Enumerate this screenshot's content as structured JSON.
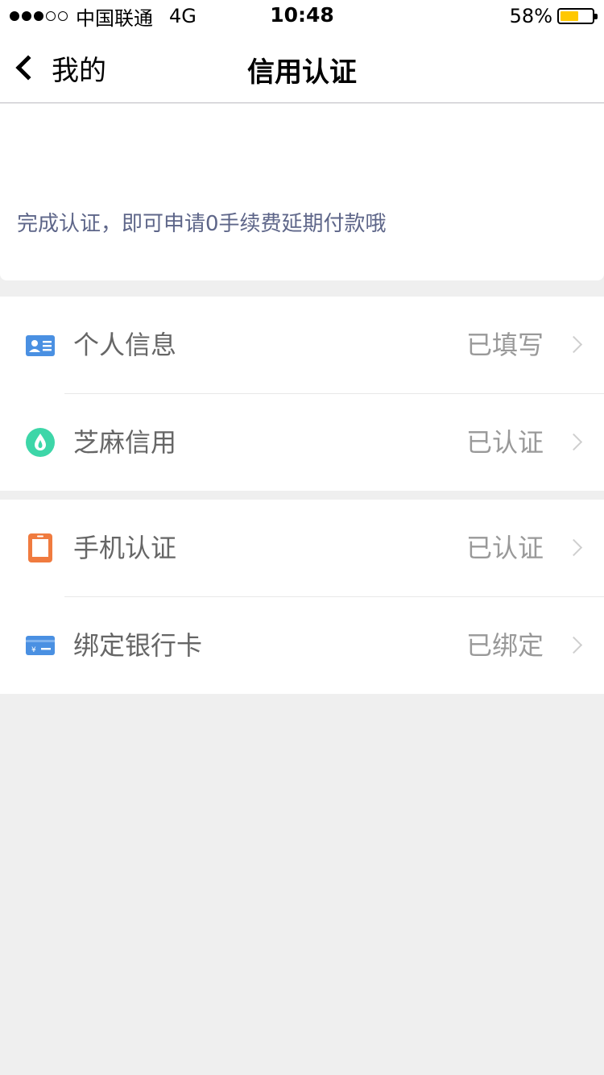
{
  "status_bar": {
    "carrier": "中国联通",
    "network": "4G",
    "time": "10:48",
    "battery": "58%",
    "battery_level": 0.58,
    "signal_strength": 3
  },
  "nav": {
    "back_label": "我的",
    "title": "信用认证"
  },
  "banner": {
    "text": "完成认证，即可申请0手续费延期付款哦"
  },
  "groups": [
    {
      "items": [
        {
          "label": "个人信息",
          "status": "已填写",
          "icon": "id-card-icon",
          "color": "#4a90e2"
        },
        {
          "label": "芝麻信用",
          "status": "已认证",
          "icon": "sesame-credit-icon",
          "color": "#3dd6a8"
        }
      ]
    },
    {
      "items": [
        {
          "label": "手机认证",
          "status": "已认证",
          "icon": "phone-icon",
          "color": "#f07b3f"
        },
        {
          "label": "绑定银行卡",
          "status": "已绑定",
          "icon": "bank-card-icon",
          "color": "#4a90e2"
        }
      ]
    }
  ],
  "colors": {
    "background": "#efefef",
    "banner_text": "#5e6689",
    "battery_fill": "#ffc800"
  }
}
